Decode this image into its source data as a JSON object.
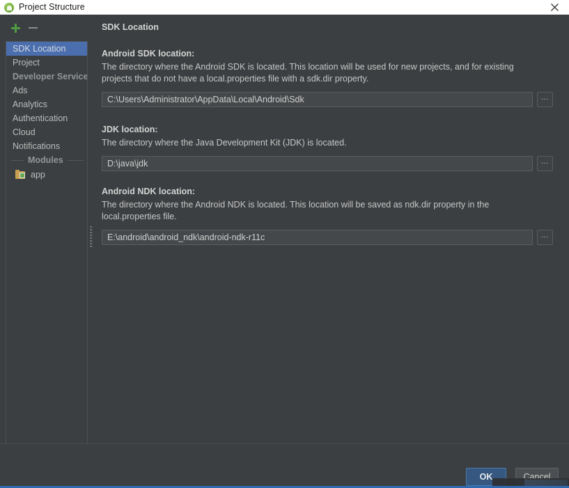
{
  "window": {
    "title": "Project Structure",
    "app_icon": "android-studio-icon",
    "close_label": "close-icon"
  },
  "toolbar": {
    "add_label": "+",
    "remove_label": "−"
  },
  "sidebar": {
    "items": [
      {
        "label": "SDK Location",
        "type": "item",
        "selected": true
      },
      {
        "label": "Project",
        "type": "item",
        "selected": false
      },
      {
        "label": "Developer Services",
        "type": "group",
        "selected": false
      },
      {
        "label": "Ads",
        "type": "item",
        "selected": false
      },
      {
        "label": "Analytics",
        "type": "item",
        "selected": false
      },
      {
        "label": "Authentication",
        "type": "item",
        "selected": false
      },
      {
        "label": "Cloud",
        "type": "item",
        "selected": false
      },
      {
        "label": "Notifications",
        "type": "item",
        "selected": false
      }
    ],
    "modules_separator": "Modules",
    "modules": [
      {
        "label": "app",
        "icon": "module-folder-icon"
      }
    ]
  },
  "content": {
    "title": "SDK Location",
    "sections": [
      {
        "label": "Android SDK location:",
        "description": "The directory where the Android SDK is located. This location will be used for new projects, and for existing projects that do not have a local.properties file with a sdk.dir property.",
        "value": "C:\\Users\\Administrator\\AppData\\Local\\Android\\Sdk",
        "placeholder": "",
        "browse_label": "…"
      },
      {
        "label": "JDK location:",
        "description": "The directory where the Java Development Kit (JDK) is located.",
        "value": "D:\\java\\jdk",
        "placeholder": "",
        "browse_label": "…"
      },
      {
        "label": "Android NDK location:",
        "description": "The directory where the Android NDK is located. This location will be saved as ndk.dir property in the local.properties file.",
        "value": "E:\\android\\android_ndk\\android-ndk-r11c",
        "placeholder": "",
        "browse_label": "…"
      }
    ]
  },
  "footer": {
    "ok_label": "OK",
    "cancel_label": "Cancel"
  },
  "colors": {
    "background": "#3c3f41",
    "titlebar": "#ffffff",
    "selection": "#4b6eaf",
    "accent_ok": "#365880",
    "add_green": "#4e9a42",
    "input_bg": "#45484a",
    "text": "#c6c6c6"
  }
}
